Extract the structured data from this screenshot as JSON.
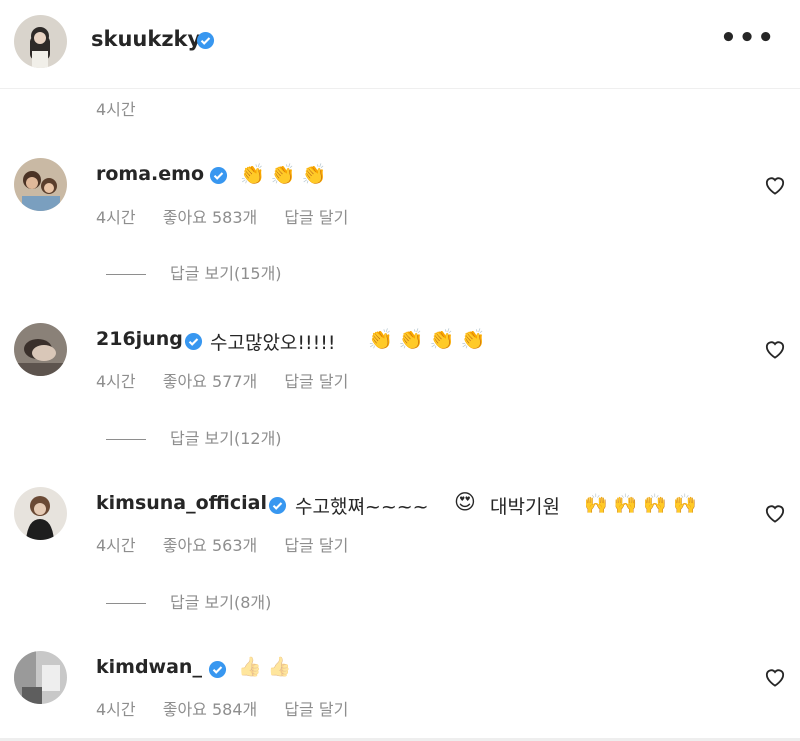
{
  "post": {
    "author": "skuukzky",
    "time": "4시간"
  },
  "comments": [
    {
      "username": "roma.emo",
      "text": "",
      "emoji": [
        "👏",
        "👏",
        "👏"
      ],
      "time": "4시간",
      "likes": "좋아요 583개",
      "reply_action": "답글 달기",
      "view_replies": "답글 보기(15개)"
    },
    {
      "username": "216jung",
      "text": "수고많았오!!!!!",
      "emoji": [
        "👏",
        "👏",
        "👏",
        "👏"
      ],
      "time": "4시간",
      "likes": "좋아요 577개",
      "reply_action": "답글 달기",
      "view_replies": "답글 보기(12개)"
    },
    {
      "username": "kimsuna_official",
      "text": "수고했쪄~~~~",
      "text2": "대박기원",
      "emoji_mid": "😍",
      "emoji": [
        "🙌",
        "🙌",
        "🙌",
        "🙌"
      ],
      "time": "4시간",
      "likes": "좋아요 563개",
      "reply_action": "답글 달기",
      "view_replies": "답글 보기(8개)"
    },
    {
      "username": "kimdwan_",
      "text": "",
      "emoji": [
        "👍",
        "👍"
      ],
      "time": "4시간",
      "likes": "좋아요 584개",
      "reply_action": "답글 달기"
    }
  ],
  "icons": {
    "verified": "verified-badge-icon",
    "heart": "heart-outline-icon",
    "more": "more-options-icon"
  },
  "colors": {
    "verified": "#3897f0",
    "secondary_text": "#8e8e8e",
    "primary_text": "#262626",
    "clap": "#f2c230"
  }
}
